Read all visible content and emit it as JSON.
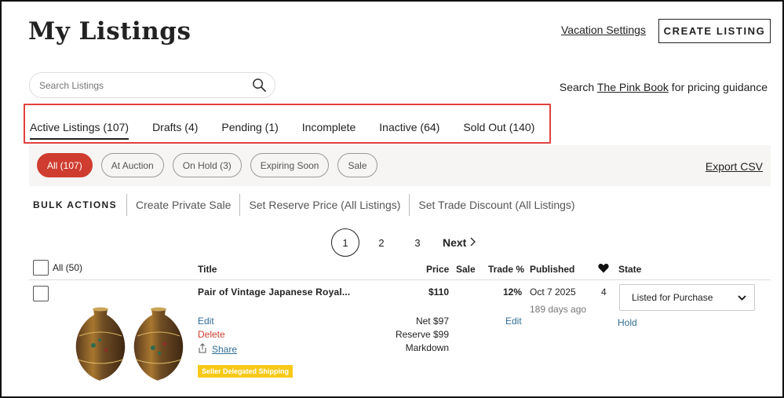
{
  "header": {
    "title": "My Listings",
    "vacation_link": "Vacation Settings",
    "create_button": "CREATE LISTING"
  },
  "search": {
    "placeholder": "Search Listings",
    "value": "",
    "pink_book_prefix": "Search ",
    "pink_book_link": "The Pink Book",
    "pink_book_suffix": " for pricing guidance"
  },
  "tabs": [
    {
      "label": "Active Listings (107)",
      "active": true
    },
    {
      "label": "Drafts (4)",
      "active": false
    },
    {
      "label": "Pending (1)",
      "active": false
    },
    {
      "label": "Incomplete",
      "active": false
    },
    {
      "label": "Inactive (64)",
      "active": false
    },
    {
      "label": "Sold Out (140)",
      "active": false
    }
  ],
  "filters": {
    "chips": [
      {
        "label": "All (107)",
        "active": true
      },
      {
        "label": "At Auction",
        "active": false
      },
      {
        "label": "On Hold (3)",
        "active": false
      },
      {
        "label": "Expiring Soon",
        "active": false
      },
      {
        "label": "Sale",
        "active": false
      }
    ],
    "export": "Export CSV"
  },
  "bulk": {
    "label": "BULK ACTIONS",
    "actions": [
      "Create Private Sale",
      "Set Reserve Price (All Listings)",
      "Set Trade Discount (All Listings)"
    ]
  },
  "pagination": {
    "pages": [
      "1",
      "2",
      "3"
    ],
    "current": "1",
    "next": "Next"
  },
  "table": {
    "select_all": "All (50)",
    "columns": {
      "title": "Title",
      "price": "Price",
      "sale": "Sale",
      "trade": "Trade %",
      "published": "Published",
      "state": "State"
    },
    "rows": [
      {
        "title": "Pair of Vintage Japanese Royal...",
        "price": "$110",
        "trade_pct": "12%",
        "published": "Oct 7 2025",
        "published_ago": "189 days ago",
        "likes": "4",
        "state": "Listed for Purchase",
        "hold": "Hold",
        "edit": "Edit",
        "delete": "Delete",
        "share": "Share",
        "badge": "Seller Delegated Shipping",
        "net": "Net $97",
        "reserve": "Reserve $99",
        "markdown": "Markdown",
        "trade_edit": "Edit"
      }
    ]
  },
  "colors": {
    "accent_red": "#cf3d30",
    "link_blue": "#2f6e95",
    "badge_yellow": "#f6c917",
    "highlight_red": "#e0413f",
    "band_bg": "#f6f5f3"
  },
  "icons": {
    "search": "magnifier-icon",
    "heart": "heart-icon",
    "share": "share-icon",
    "chevron": "chevron-down-icon",
    "next": "chevron-right-icon"
  }
}
